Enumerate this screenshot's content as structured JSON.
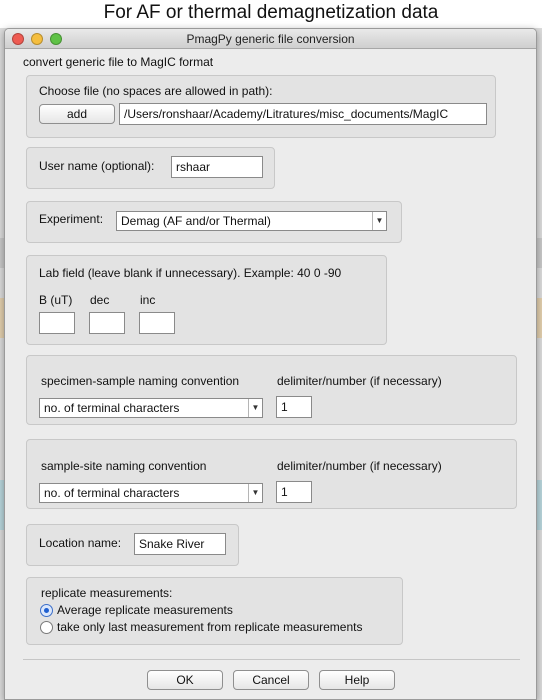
{
  "caption": "For AF or thermal demagnetization data",
  "window": {
    "title": "PmagPy generic file conversion"
  },
  "heading": "convert generic file to MagIC format",
  "choose_file": {
    "label": "Choose file (no spaces are allowed in path):",
    "add_button": "add",
    "path_value": "/Users/ronshaar/Academy/Litratures/misc_documents/MagIC"
  },
  "user_name": {
    "label": "User name (optional):",
    "value": "rshaar"
  },
  "experiment": {
    "label": "Experiment:",
    "selected": "Demag (AF and/or Thermal)"
  },
  "lab_field": {
    "label": "Lab field (leave blank if unnecessary). Example: 40 0 -90",
    "b_label": "B (uT)",
    "dec_label": "dec",
    "inc_label": "inc",
    "b_value": "",
    "dec_value": "",
    "inc_value": ""
  },
  "specimen_sample": {
    "label": "specimen-sample naming convention",
    "delimiter_label": "delimiter/number (if necessary)",
    "selected": "no. of terminal characters",
    "delimiter_value": "1"
  },
  "sample_site": {
    "label": "sample-site naming convention",
    "delimiter_label": "delimiter/number (if necessary)",
    "selected": "no. of terminal characters",
    "delimiter_value": "1"
  },
  "location": {
    "label": "Location name:",
    "value": "Snake River"
  },
  "replicate": {
    "label": "replicate measurements:",
    "option_average": "Average replicate measurements",
    "option_last": "take only last measurement from replicate measurements",
    "selected": "average"
  },
  "buttons": {
    "ok": "OK",
    "cancel": "Cancel",
    "help": "Help"
  },
  "colors": {
    "radio_selected": "#1f5fd0",
    "dialog_bg": "#ececec",
    "group_bg": "#e3e3e3"
  },
  "icons": {
    "dropdown": "chevron-down-icon",
    "close": "close-icon",
    "minimize": "minimize-icon",
    "zoom": "zoom-icon"
  }
}
